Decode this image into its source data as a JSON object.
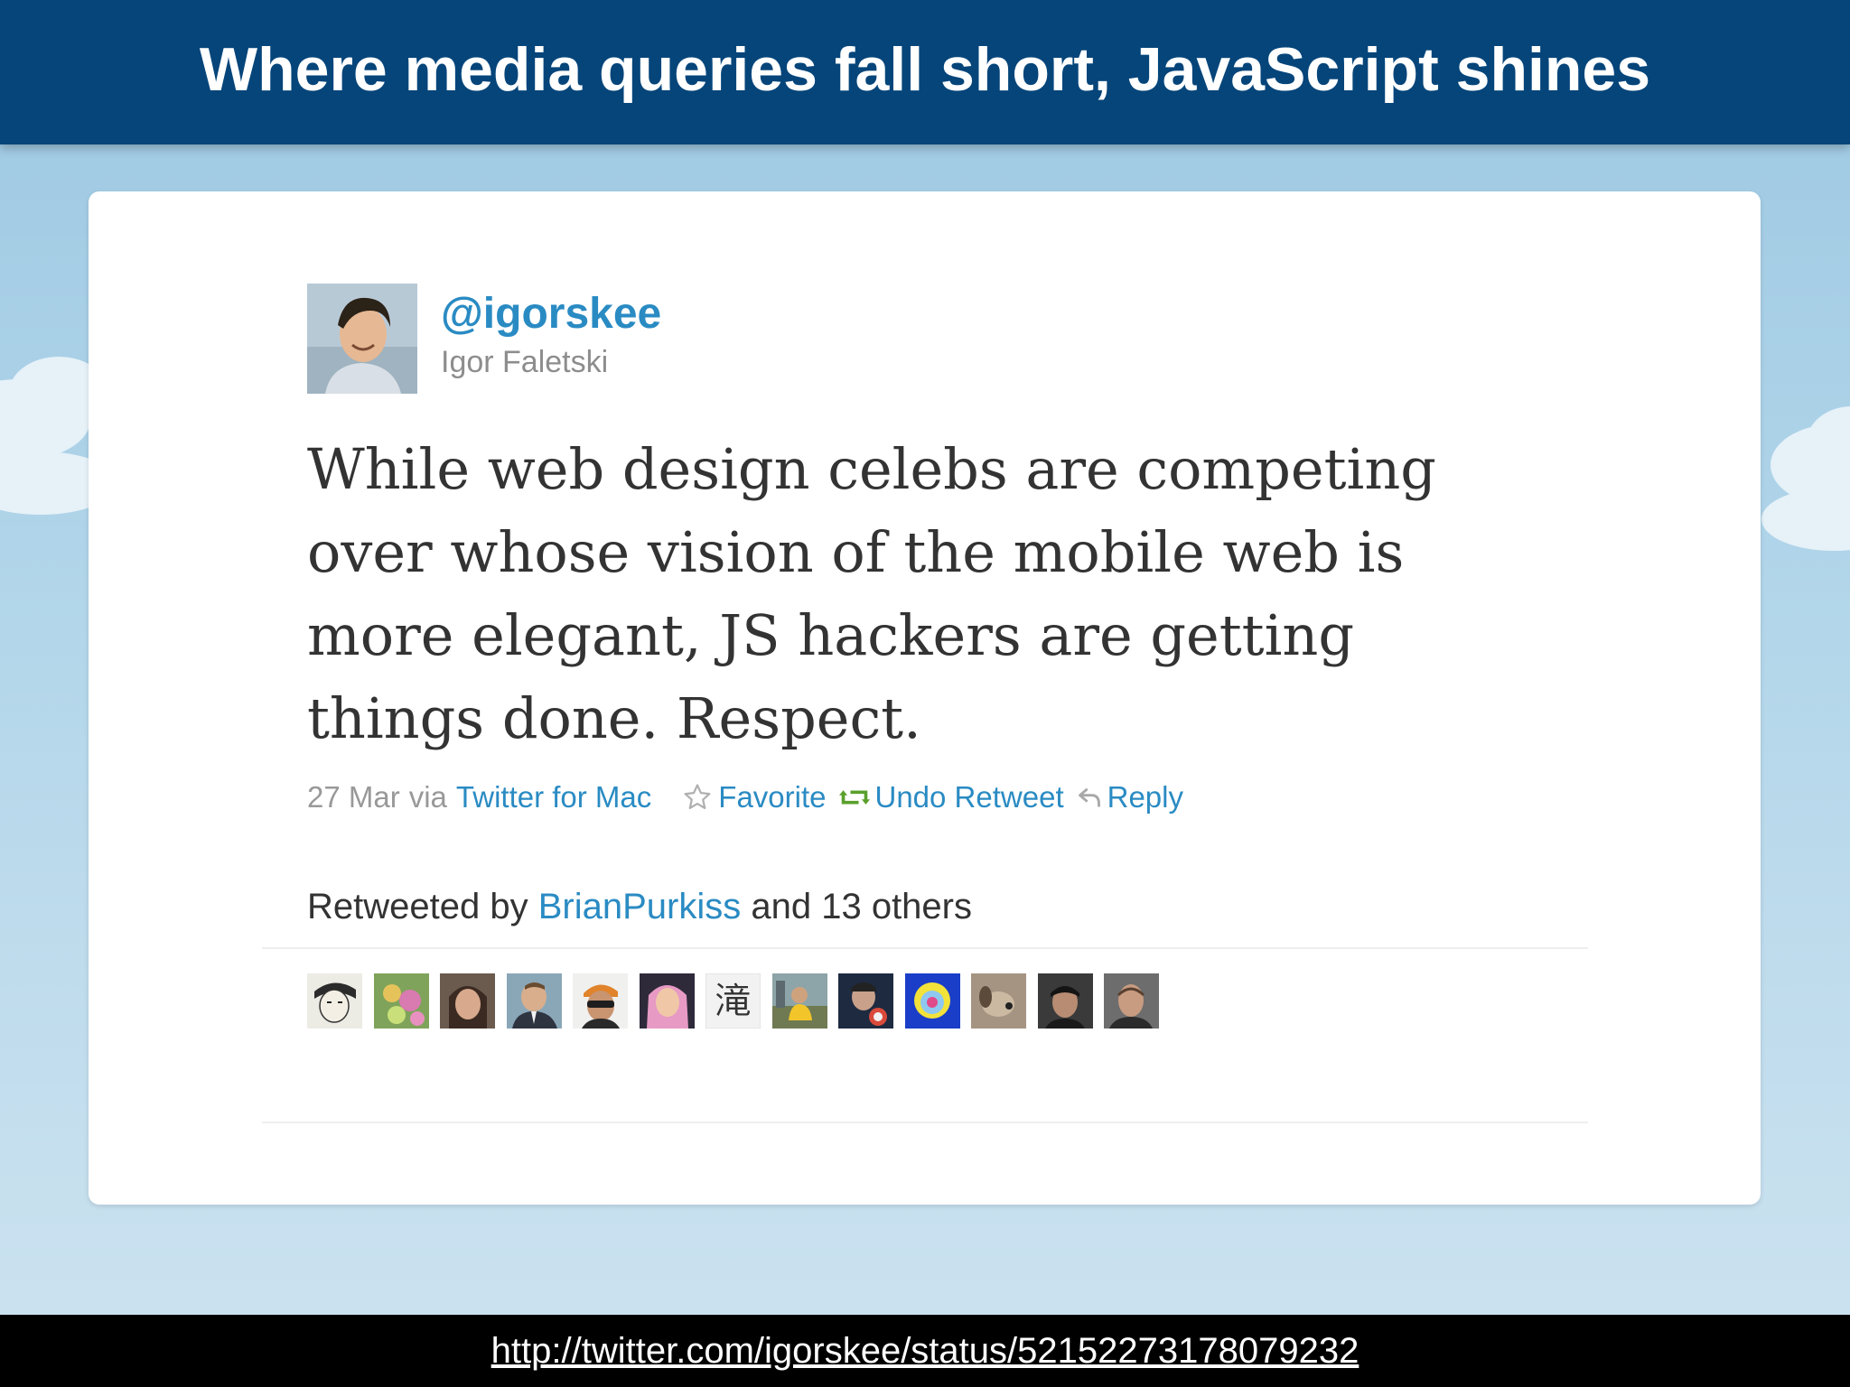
{
  "slide": {
    "title": "Where media queries fall short, JavaScript shines",
    "footer_url": "http://twitter.com/igorskee/status/52152273178079232"
  },
  "tweet": {
    "handle": "@igorskee",
    "full_name": "Igor Faletski",
    "text": "While web design celebs are competing over whose vision of the mobile web is more elegant, JS hackers are getting things done. Respect.",
    "date": "27 Mar",
    "via_prefix": "via",
    "source": "Twitter for Mac",
    "actions": {
      "favorite": "Favorite",
      "undo_retweet": "Undo Retweet",
      "reply": "Reply"
    },
    "retweeted": {
      "prefix": "Retweeted by",
      "user": "BrianPurkiss",
      "suffix": "and 13 others"
    },
    "retweeter_avatars": [
      {
        "icon": "avatar-sketch-face"
      },
      {
        "icon": "avatar-flowers"
      },
      {
        "icon": "avatar-woman-dark-hair"
      },
      {
        "icon": "avatar-man-suit"
      },
      {
        "icon": "avatar-man-orange-sunglasses"
      },
      {
        "icon": "avatar-woman-pink-hair"
      },
      {
        "icon": "avatar-kanji",
        "text": "滝"
      },
      {
        "icon": "avatar-outdoor-yellow"
      },
      {
        "icon": "avatar-man-dark-red"
      },
      {
        "icon": "avatar-colorful-blue-yellow"
      },
      {
        "icon": "avatar-dog-profile"
      },
      {
        "icon": "avatar-man-dark-hair"
      },
      {
        "icon": "avatar-man-bald"
      }
    ]
  },
  "colors": {
    "header_bg": "#05457a",
    "link_blue": "#2a8bc3",
    "retweet_green": "#5aa02c"
  }
}
